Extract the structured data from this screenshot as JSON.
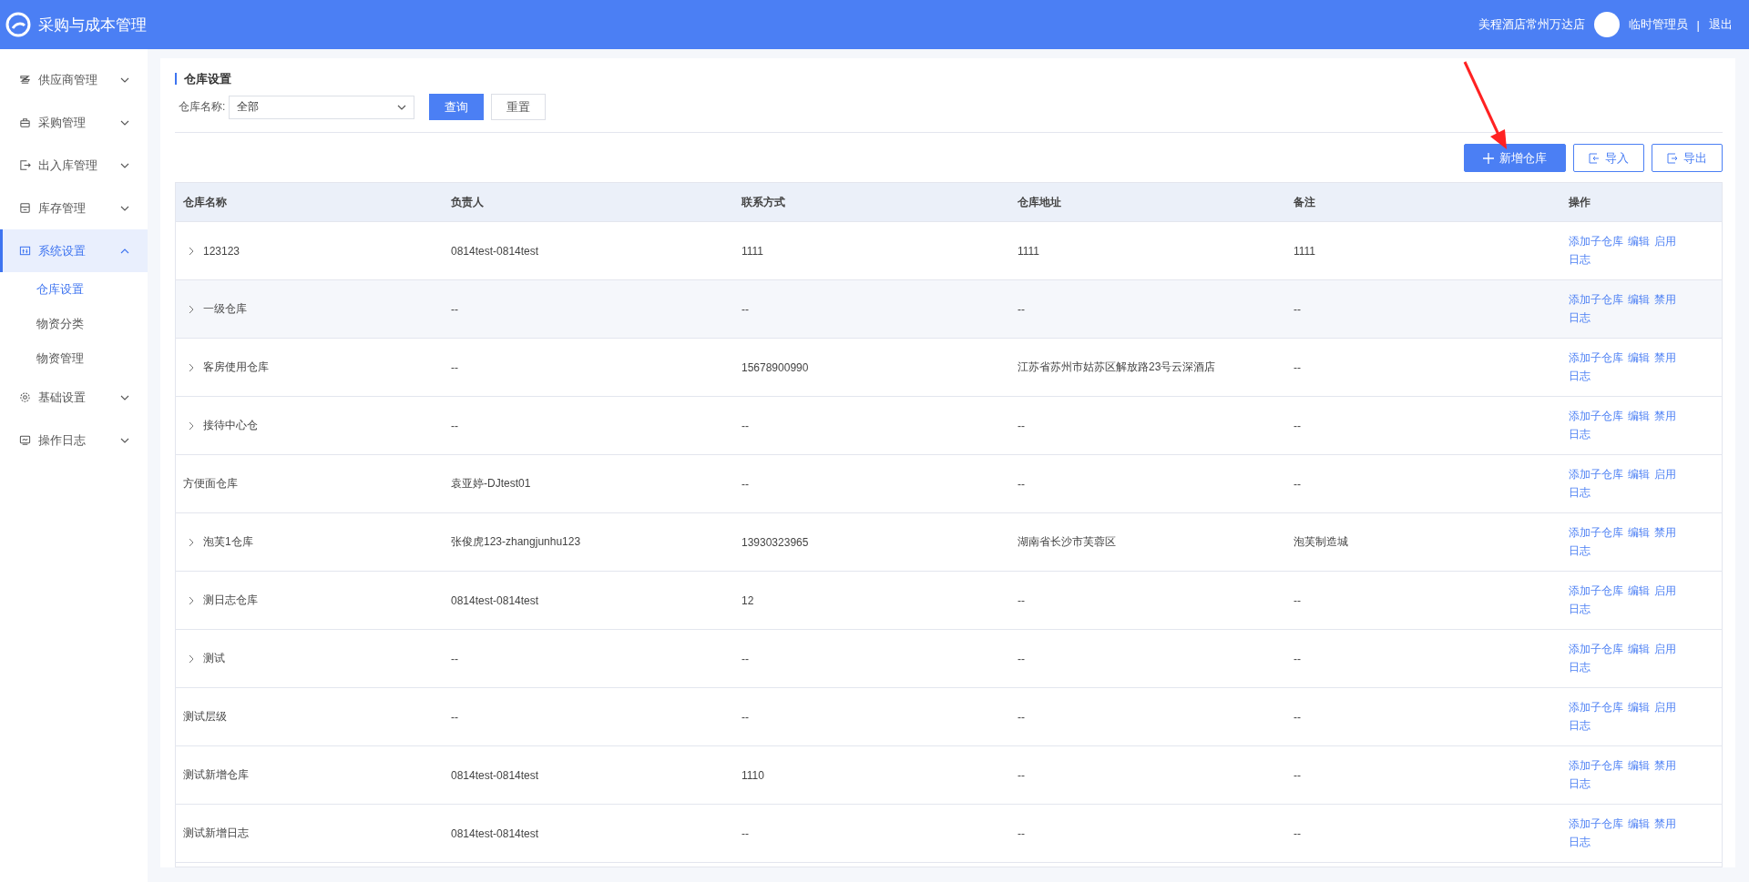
{
  "header": {
    "app_title": "采购与成本管理",
    "store": "美程酒店常州万达店",
    "user": "临时管理员",
    "separator": "|",
    "logout": "退出"
  },
  "sidebar": {
    "items": [
      {
        "label": "供应商管理",
        "expanded": false,
        "selected": false
      },
      {
        "label": "采购管理",
        "expanded": false,
        "selected": false
      },
      {
        "label": "出入库管理",
        "expanded": false,
        "selected": false
      },
      {
        "label": "库存管理",
        "expanded": false,
        "selected": false
      },
      {
        "label": "系统设置",
        "expanded": true,
        "selected": true,
        "children": [
          {
            "label": "仓库设置",
            "selected": true
          },
          {
            "label": "物资分类",
            "selected": false
          },
          {
            "label": "物资管理",
            "selected": false
          }
        ]
      },
      {
        "label": "基础设置",
        "expanded": false,
        "selected": false
      },
      {
        "label": "操作日志",
        "expanded": false,
        "selected": false
      }
    ]
  },
  "page": {
    "title": "仓库设置",
    "filter": {
      "label": "仓库名称:",
      "value": "全部",
      "query": "查询",
      "reset": "重置"
    },
    "toolbar": [
      {
        "label": "新增仓库",
        "kind": "primary"
      },
      {
        "label": "导入",
        "kind": "import"
      },
      {
        "label": "导出",
        "kind": "export"
      }
    ],
    "table": {
      "columns": [
        "仓库名称",
        "负责人",
        "联系方式",
        "仓库地址",
        "备注",
        "操作"
      ],
      "rows": [
        {
          "cells": [
            "123123",
            "0814test-0814test",
            "1111",
            "1111",
            "1111"
          ],
          "expandable": true,
          "highlighted": false,
          "actions": [
            "添加子仓库",
            "编辑",
            "启用",
            "日志"
          ]
        },
        {
          "cells": [
            "一级仓库",
            "--",
            "--",
            "--",
            "--"
          ],
          "expandable": true,
          "highlighted": true,
          "actions": [
            "添加子仓库",
            "编辑",
            "禁用",
            "日志"
          ]
        },
        {
          "cells": [
            "客房使用仓库",
            "--",
            "15678900990",
            "江苏省苏州市姑苏区解放路23号云深酒店",
            "--"
          ],
          "expandable": true,
          "highlighted": false,
          "actions": [
            "添加子仓库",
            "编辑",
            "禁用",
            "日志"
          ]
        },
        {
          "cells": [
            "接待中心仓",
            "--",
            "--",
            "--",
            "--"
          ],
          "expandable": true,
          "highlighted": false,
          "actions": [
            "添加子仓库",
            "编辑",
            "禁用",
            "日志"
          ]
        },
        {
          "cells": [
            "方便面仓库",
            "袁亚婷-DJtest01",
            "--",
            "--",
            "--"
          ],
          "expandable": false,
          "highlighted": false,
          "actions": [
            "添加子仓库",
            "编辑",
            "启用",
            "日志"
          ]
        },
        {
          "cells": [
            "泡芙1仓库",
            "张俊虎123-zhangjunhu123",
            "13930323965",
            "湖南省长沙市芙蓉区",
            "泡芙制造城"
          ],
          "expandable": true,
          "highlighted": false,
          "actions": [
            "添加子仓库",
            "编辑",
            "禁用",
            "日志"
          ]
        },
        {
          "cells": [
            "测日志仓库",
            "0814test-0814test",
            "12",
            "--",
            "--"
          ],
          "expandable": true,
          "highlighted": false,
          "actions": [
            "添加子仓库",
            "编辑",
            "启用",
            "日志"
          ]
        },
        {
          "cells": [
            "测试",
            "--",
            "--",
            "--",
            "--"
          ],
          "expandable": true,
          "highlighted": false,
          "actions": [
            "添加子仓库",
            "编辑",
            "启用",
            "日志"
          ]
        },
        {
          "cells": [
            "测试层级",
            "--",
            "--",
            "--",
            "--"
          ],
          "expandable": false,
          "highlighted": false,
          "actions": [
            "添加子仓库",
            "编辑",
            "启用",
            "日志"
          ]
        },
        {
          "cells": [
            "测试新增仓库",
            "0814test-0814test",
            "1110",
            "--",
            "--"
          ],
          "expandable": false,
          "highlighted": false,
          "actions": [
            "添加子仓库",
            "编辑",
            "禁用",
            "日志"
          ]
        },
        {
          "cells": [
            "测试新增日志",
            "0814test-0814test",
            "--",
            "--",
            "--"
          ],
          "expandable": false,
          "highlighted": false,
          "actions": [
            "添加子仓库",
            "编辑",
            "禁用",
            "日志"
          ]
        }
      ]
    }
  }
}
